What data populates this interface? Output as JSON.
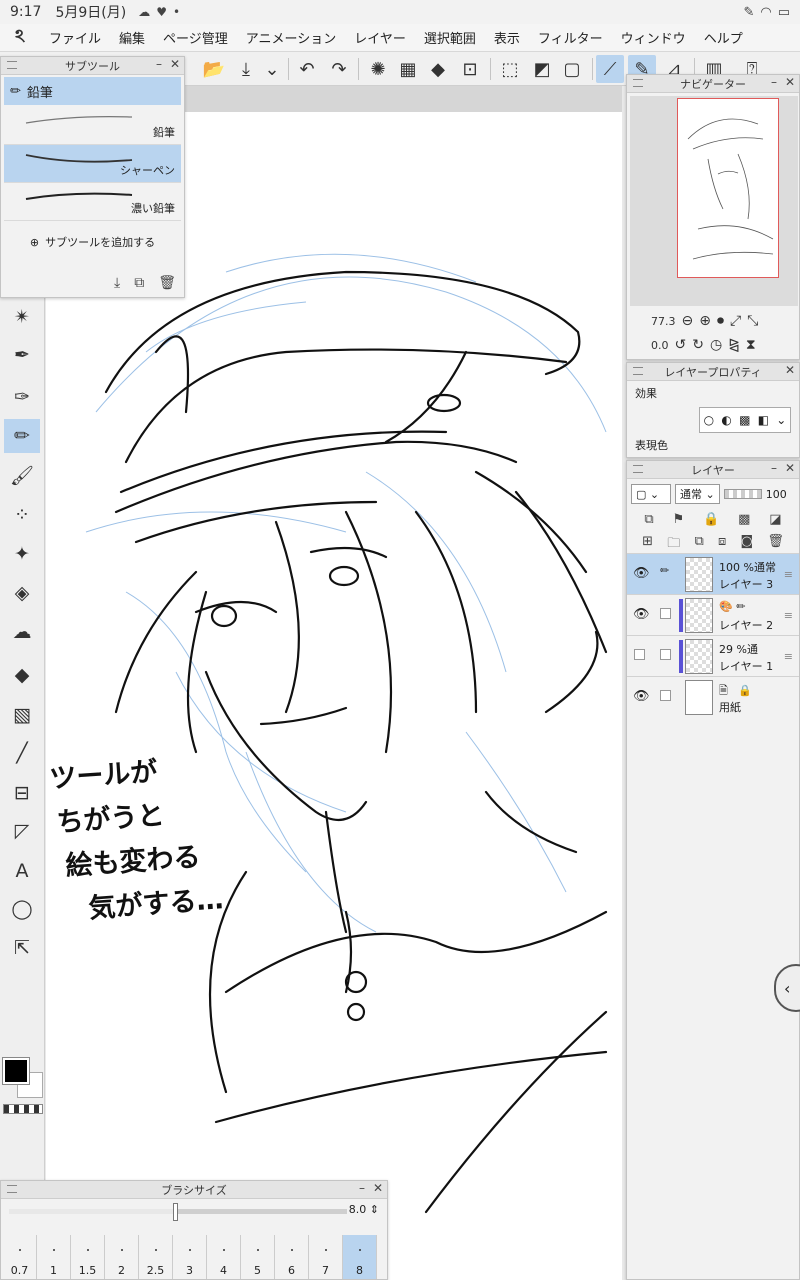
{
  "status": {
    "time": "9:17",
    "date": "5月9日(月)"
  },
  "menu": [
    "ファイル",
    "編集",
    "ページ管理",
    "アニメーション",
    "レイヤー",
    "選択範囲",
    "表示",
    "フィルター",
    "ウィンドウ",
    "ヘルプ"
  ],
  "subtool": {
    "title": "サブツール",
    "group": "鉛筆",
    "items": [
      {
        "label": "鉛筆",
        "selected": false
      },
      {
        "label": "シャーペン",
        "selected": true
      },
      {
        "label": "濃い鉛筆",
        "selected": false
      }
    ],
    "add_label": "サブツールを追加する"
  },
  "navigator": {
    "title": "ナビゲーター",
    "zoom": "77.3",
    "rotation": "0.0"
  },
  "layer_property": {
    "title": "レイヤープロパティ",
    "effects_label": "効果",
    "color_label": "表現色"
  },
  "layers": {
    "title": "レイヤー",
    "blend_mode": "通常",
    "opacity": "100",
    "list": [
      {
        "line1": "100 %通常",
        "line2": "レイヤー 3",
        "selected": true,
        "visible": true
      },
      {
        "line1": "",
        "line2": "レイヤー 2",
        "selected": false,
        "visible": true
      },
      {
        "line1": "29 %通",
        "line2": "レイヤー 1",
        "selected": false,
        "visible": false
      },
      {
        "line1": "",
        "line2": "用紙",
        "selected": false,
        "visible": true
      }
    ]
  },
  "brush": {
    "title": "ブラシサイズ",
    "value": "8.0",
    "value_fraction": 0.5,
    "sizes": [
      "0.7",
      "1",
      "1.5",
      "2",
      "2.5",
      "3",
      "4",
      "5",
      "6",
      "7",
      "8"
    ],
    "selected": "8"
  },
  "canvas_text": [
    "ツールが",
    "ちがうと",
    "絵も変わる",
    "気がする…"
  ]
}
